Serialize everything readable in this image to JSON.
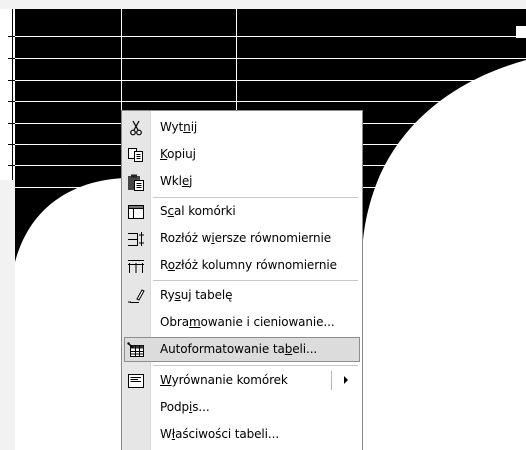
{
  "menu": {
    "items": [
      {
        "name": "cut",
        "label": "Wytnij",
        "icon": "scissors-icon"
      },
      {
        "name": "copy",
        "label": "Kopiuj",
        "icon": "copy-icon"
      },
      {
        "name": "paste",
        "label": "Wklej",
        "icon": "paste-icon"
      },
      {
        "name": "merge-cells",
        "label": "Scal komórki",
        "icon": "merge-cells-icon"
      },
      {
        "name": "distribute-rows",
        "label": "Rozłóż wiersze równomiernie",
        "icon": "distribute-rows-icon"
      },
      {
        "name": "distribute-columns",
        "label": "Rozłóż kolumny równomiernie",
        "icon": "distribute-columns-icon"
      },
      {
        "name": "draw-table",
        "label": "Rysuj tabelę",
        "icon": "pencil-icon"
      },
      {
        "name": "borders-shading",
        "label": "Obramowanie i cieniowanie..."
      },
      {
        "name": "table-autoformat",
        "label": "Autoformatowanie tabeli...",
        "icon": "table-autoformat-icon",
        "highlighted": true
      },
      {
        "name": "cell-alignment",
        "label": "Wyrównanie komórek",
        "icon": "align-icon",
        "submenu": true
      },
      {
        "name": "caption",
        "label": "Podpis..."
      },
      {
        "name": "table-properties",
        "label": "Właściwości tabeli..."
      }
    ]
  }
}
